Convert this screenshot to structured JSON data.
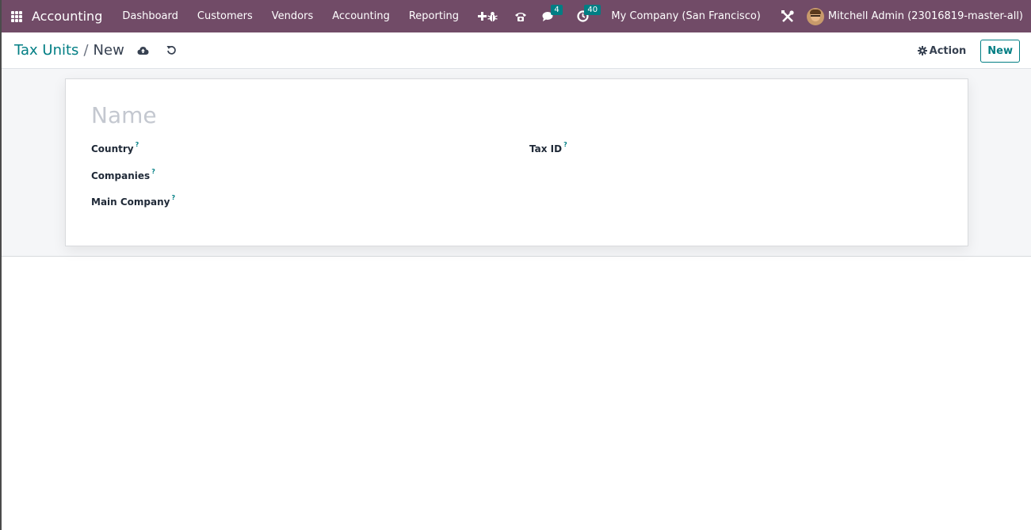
{
  "navbar": {
    "app_name": "Accounting",
    "menu": [
      "Dashboard",
      "Customers",
      "Vendors",
      "Accounting",
      "Reporting"
    ],
    "messages_count": "4",
    "activities_count": "40",
    "company": "My Company (San Francisco)",
    "user": "Mitchell Admin (23016819-master-all)",
    "icons": [
      "apps-grid-icon",
      "plus-icon",
      "bug-icon",
      "phone-icon",
      "chat-icon",
      "clock-icon",
      "tools-icon"
    ],
    "brand_color": "#714b67"
  },
  "control_panel": {
    "breadcrumb_parent": "Tax Units",
    "breadcrumb_separator": "/",
    "breadcrumb_current": "New",
    "action_label": "Action",
    "new_label": "New",
    "icons": [
      "save-cloud-icon",
      "discard-icon",
      "gear-icon"
    ],
    "accent_color": "#017e84"
  },
  "form": {
    "name_placeholder": "Name",
    "help_marker": "?",
    "fields_left": [
      "Country",
      "Companies",
      "Main Company"
    ],
    "fields_right": [
      "Tax ID"
    ]
  }
}
